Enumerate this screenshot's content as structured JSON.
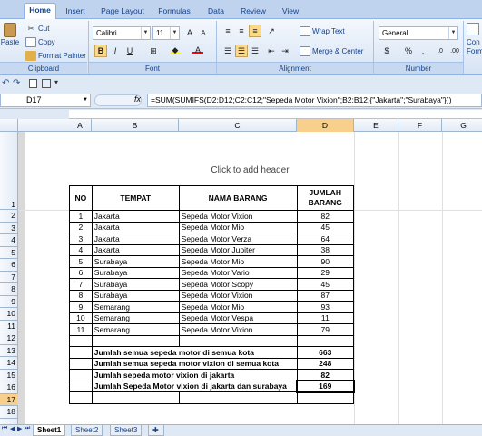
{
  "ribbon": {
    "tabs": [
      "Home",
      "Insert",
      "Page Layout",
      "Formulas",
      "Data",
      "Review",
      "View"
    ],
    "clipboard": {
      "paste": "Paste",
      "cut": "Cut",
      "copy": "Copy",
      "format_painter": "Format Painter",
      "label": "Clipboard"
    },
    "font": {
      "name": "Calibri",
      "size": "11",
      "label": "Font",
      "bold": "B",
      "italic": "I",
      "underline": "U"
    },
    "alignment": {
      "wrap_text": "Wrap Text",
      "merge_center": "Merge & Center",
      "label": "Alignment"
    },
    "number": {
      "format": "General",
      "label": "Number",
      "currency": "$",
      "percent": "%",
      "comma": ","
    },
    "styles": {
      "cond": "Con",
      "format": "Form"
    }
  },
  "formula_bar": {
    "name_box": "D17",
    "fx": "fx",
    "formula": "=SUM(SUMIFS(D2:D12;C2:C12;\"Sepeda Motor Vixion\";B2:B12;{\"Jakarta\";\"Surabaya\"}))"
  },
  "columns": [
    "A",
    "B",
    "C",
    "D",
    "E",
    "F",
    "G"
  ],
  "rows": [
    "1",
    "2",
    "3",
    "4",
    "5",
    "6",
    "7",
    "8",
    "9",
    "10",
    "11",
    "12",
    "13",
    "14",
    "15",
    "16",
    "17",
    "18"
  ],
  "header_hint": "Click to add header",
  "table": {
    "headers": {
      "no": "NO",
      "tempat": "TEMPAT",
      "nama_barang": "NAMA BARANG",
      "jumlah_1": "JUMLAH",
      "jumlah_2": "BARANG"
    },
    "rows": [
      {
        "no": "1",
        "tempat": "Jakarta",
        "barang": "Sepeda Motor Vixion",
        "jumlah": "82"
      },
      {
        "no": "2",
        "tempat": "Jakarta",
        "barang": "Sepeda Motor Mio",
        "jumlah": "45"
      },
      {
        "no": "3",
        "tempat": "Jakarta",
        "barang": "Sepeda Motor Verza",
        "jumlah": "64"
      },
      {
        "no": "4",
        "tempat": "Jakarta",
        "barang": "Sepeda Motor Jupiter",
        "jumlah": "38"
      },
      {
        "no": "5",
        "tempat": "Surabaya",
        "barang": "Sepeda Motor Mio",
        "jumlah": "90"
      },
      {
        "no": "6",
        "tempat": "Surabaya",
        "barang": "Sepeda Motor Vario",
        "jumlah": "29"
      },
      {
        "no": "7",
        "tempat": "Surabaya",
        "barang": "Sepeda Motor Scopy",
        "jumlah": "45"
      },
      {
        "no": "8",
        "tempat": "Surabaya",
        "barang": "Sepeda Motor Vixion",
        "jumlah": "87"
      },
      {
        "no": "9",
        "tempat": "Semarang",
        "barang": "Sepeda Motor Mio",
        "jumlah": "93"
      },
      {
        "no": "10",
        "tempat": "Semarang",
        "barang": "Sepeda Motor Vespa",
        "jumlah": "11"
      },
      {
        "no": "11",
        "tempat": "Semarang",
        "barang": "Sepeda Motor Vixion",
        "jumlah": "79"
      }
    ],
    "summary": [
      {
        "label": "Jumlah semua sepeda motor di semua kota",
        "value": "663"
      },
      {
        "label": "Jumlah semua sepeda motor vixion di semua kota",
        "value": "248"
      },
      {
        "label": "Jumlah sepeda motor vixion di jakarta",
        "value": "82"
      },
      {
        "label": "Jumlah Sepeda Motor vixion di jakarta dan surabaya",
        "value": "169"
      }
    ]
  },
  "sheet_tabs": [
    "Sheet1",
    "Sheet2",
    "Sheet3"
  ],
  "colors": {
    "accent": "#15428b",
    "selected": "#f8d08c"
  }
}
